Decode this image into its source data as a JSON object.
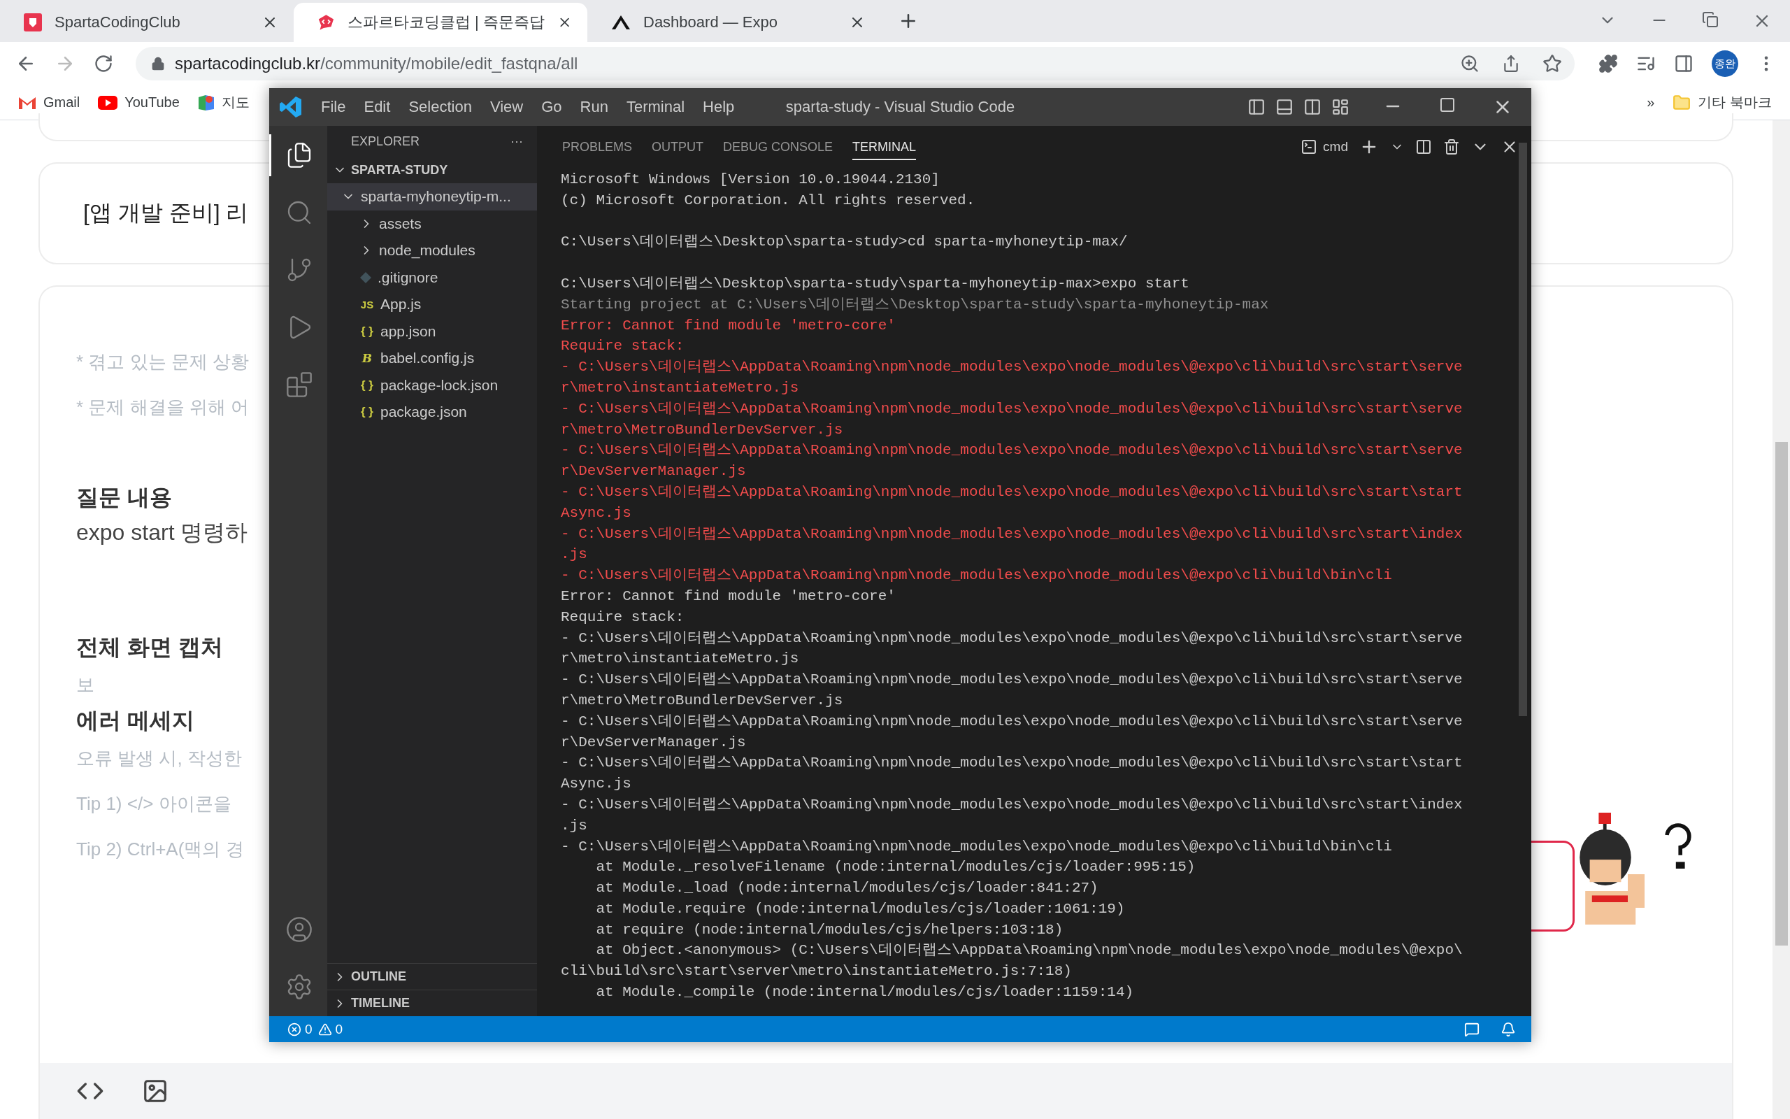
{
  "browser": {
    "tabs": [
      {
        "title": "SpartaCodingClub",
        "selected": false,
        "kind": "sparta"
      },
      {
        "title": "스파르타코딩클럽 | 즉문즉답",
        "selected": true,
        "kind": "chat"
      },
      {
        "title": "Dashboard — Expo",
        "selected": false,
        "kind": "expo"
      }
    ],
    "address": {
      "host": "spartacodingclub.kr",
      "path": "/community/mobile/edit_fastqna/all"
    },
    "profile": "종완",
    "bookmarks": [
      {
        "label": "Gmail",
        "kind": "gmail"
      },
      {
        "label": "YouTube",
        "kind": "youtube"
      },
      {
        "label": "지도",
        "kind": "maps"
      }
    ],
    "bookmarks_more": "»",
    "other_bookmarks": "기타 북마크"
  },
  "page": {
    "post_title": "[앱 개발 준비] 리",
    "hints": [
      "* 겪고 있는 문제 상황",
      "* 문제 해결을 위해 어"
    ],
    "question_heading": "질문 내용",
    "question_text": "expo start 명령하",
    "capture_heading": "전체 화면 캡처",
    "capture_text": "보",
    "error_heading": "에러 메세지",
    "error_hints": [
      "오류 발생 시, 작성한",
      "Tip 1) </> 아이콘을",
      "Tip 2) Ctrl+A(맥의 경"
    ]
  },
  "vscode": {
    "title": "sparta-study - Visual Studio Code",
    "menu": [
      "File",
      "Edit",
      "Selection",
      "View",
      "Go",
      "Run",
      "Terminal",
      "Help"
    ],
    "activity": [
      {
        "kind": "files",
        "selected": true
      },
      {
        "kind": "search",
        "selected": false
      },
      {
        "kind": "git",
        "selected": false
      },
      {
        "kind": "debug",
        "selected": false
      },
      {
        "kind": "extensions",
        "selected": false
      }
    ],
    "sidebar": {
      "title": "EXPLORER",
      "more": "···",
      "root": "SPARTA-STUDY",
      "tree": [
        {
          "name": "sparta-myhoneytip-m...",
          "kind": "folder",
          "expanded": true,
          "selected": true,
          "children": [
            {
              "name": "assets",
              "kind": "folder",
              "expanded": false,
              "selected": false
            },
            {
              "name": "node_modules",
              "kind": "folder",
              "expanded": false,
              "selected": false
            },
            {
              "name": ".gitignore",
              "kind": "git",
              "selected": false
            },
            {
              "name": "App.js",
              "kind": "js",
              "badge": "JS",
              "selected": false
            },
            {
              "name": "app.json",
              "kind": "json",
              "badge": "{ }",
              "selected": false
            },
            {
              "name": "babel.config.js",
              "kind": "babel",
              "badge": "B",
              "selected": false
            },
            {
              "name": "package-lock.json",
              "kind": "json",
              "badge": "{ }",
              "selected": false
            },
            {
              "name": "package.json",
              "kind": "json",
              "badge": "{ }",
              "selected": false
            }
          ]
        }
      ],
      "sections": [
        {
          "label": "OUTLINE",
          "expanded": false
        },
        {
          "label": "TIMELINE",
          "expanded": false
        }
      ]
    },
    "panel": {
      "tabs": [
        {
          "label": "PROBLEMS",
          "selected": false
        },
        {
          "label": "OUTPUT",
          "selected": false
        },
        {
          "label": "DEBUG CONSOLE",
          "selected": false
        },
        {
          "label": "TERMINAL",
          "selected": true
        }
      ],
      "shell": "cmd",
      "lines": [
        {
          "kind": "out",
          "text": "Microsoft Windows [Version 10.0.19044.2130]"
        },
        {
          "kind": "out",
          "text": "(c) Microsoft Corporation. All rights reserved."
        },
        {
          "kind": "blank"
        },
        {
          "kind": "out",
          "text": "C:\\Users\\데이터랩스\\Desktop\\sparta-study>cd sparta-myhoneytip-max/"
        },
        {
          "kind": "blank"
        },
        {
          "kind": "out",
          "text": "C:\\Users\\데이터랩스\\Desktop\\sparta-study\\sparta-myhoneytip-max>expo start"
        },
        {
          "kind": "dim",
          "text": "Starting project at C:\\Users\\데이터랩스\\Desktop\\sparta-study\\sparta-myhoneytip-max"
        },
        {
          "kind": "error",
          "text": "Error: Cannot find module 'metro-core'"
        },
        {
          "kind": "error",
          "text": "Require stack:"
        },
        {
          "kind": "error",
          "text": "- C:\\Users\\데이터랩스\\AppData\\Roaming\\npm\\node_modules\\expo\\node_modules\\@expo\\cli\\build\\src\\start\\serve"
        },
        {
          "kind": "error",
          "text": "r\\metro\\instantiateMetro.js"
        },
        {
          "kind": "error",
          "text": "- C:\\Users\\데이터랩스\\AppData\\Roaming\\npm\\node_modules\\expo\\node_modules\\@expo\\cli\\build\\src\\start\\serve"
        },
        {
          "kind": "error",
          "text": "r\\metro\\MetroBundlerDevServer.js"
        },
        {
          "kind": "error",
          "text": "- C:\\Users\\데이터랩스\\AppData\\Roaming\\npm\\node_modules\\expo\\node_modules\\@expo\\cli\\build\\src\\start\\serve"
        },
        {
          "kind": "error",
          "text": "r\\DevServerManager.js"
        },
        {
          "kind": "error",
          "text": "- C:\\Users\\데이터랩스\\AppData\\Roaming\\npm\\node_modules\\expo\\node_modules\\@expo\\cli\\build\\src\\start\\start"
        },
        {
          "kind": "error",
          "text": "Async.js"
        },
        {
          "kind": "error",
          "text": "- C:\\Users\\데이터랩스\\AppData\\Roaming\\npm\\node_modules\\expo\\node_modules\\@expo\\cli\\build\\src\\start\\index"
        },
        {
          "kind": "error",
          "text": ".js"
        },
        {
          "kind": "error",
          "text": "- C:\\Users\\데이터랩스\\AppData\\Roaming\\npm\\node_modules\\expo\\node_modules\\@expo\\cli\\build\\bin\\cli"
        },
        {
          "kind": "out",
          "text": "Error: Cannot find module 'metro-core'"
        },
        {
          "kind": "out",
          "text": "Require stack:"
        },
        {
          "kind": "out",
          "text": "- C:\\Users\\데이터랩스\\AppData\\Roaming\\npm\\node_modules\\expo\\node_modules\\@expo\\cli\\build\\src\\start\\serve"
        },
        {
          "kind": "out",
          "text": "r\\metro\\instantiateMetro.js"
        },
        {
          "kind": "out",
          "text": "- C:\\Users\\데이터랩스\\AppData\\Roaming\\npm\\node_modules\\expo\\node_modules\\@expo\\cli\\build\\src\\start\\serve"
        },
        {
          "kind": "out",
          "text": "r\\metro\\MetroBundlerDevServer.js"
        },
        {
          "kind": "out",
          "text": "- C:\\Users\\데이터랩스\\AppData\\Roaming\\npm\\node_modules\\expo\\node_modules\\@expo\\cli\\build\\src\\start\\serve"
        },
        {
          "kind": "out",
          "text": "r\\DevServerManager.js"
        },
        {
          "kind": "out",
          "text": "- C:\\Users\\데이터랩스\\AppData\\Roaming\\npm\\node_modules\\expo\\node_modules\\@expo\\cli\\build\\src\\start\\start"
        },
        {
          "kind": "out",
          "text": "Async.js"
        },
        {
          "kind": "out",
          "text": "- C:\\Users\\데이터랩스\\AppData\\Roaming\\npm\\node_modules\\expo\\node_modules\\@expo\\cli\\build\\src\\start\\index"
        },
        {
          "kind": "out",
          "text": ".js"
        },
        {
          "kind": "out",
          "text": "- C:\\Users\\데이터랩스\\AppData\\Roaming\\npm\\node_modules\\expo\\node_modules\\@expo\\cli\\build\\bin\\cli"
        },
        {
          "kind": "out",
          "text": "    at Module._resolveFilename (node:internal/modules/cjs/loader:995:15)"
        },
        {
          "kind": "out",
          "text": "    at Module._load (node:internal/modules/cjs/loader:841:27)"
        },
        {
          "kind": "out",
          "text": "    at Module.require (node:internal/modules/cjs/loader:1061:19)"
        },
        {
          "kind": "out",
          "text": "    at require (node:internal/modules/cjs/helpers:103:18)"
        },
        {
          "kind": "out",
          "text": "    at Object.<anonymous> (C:\\Users\\데이터랩스\\AppData\\Roaming\\npm\\node_modules\\expo\\node_modules\\@expo\\"
        },
        {
          "kind": "out",
          "text": "cli\\build\\src\\start\\server\\metro\\instantiateMetro.js:7:18)"
        },
        {
          "kind": "out",
          "text": "    at Module._compile (node:internal/modules/cjs/loader:1159:14)"
        }
      ]
    },
    "status_bar": {
      "errors": "0",
      "warnings": "0"
    }
  }
}
